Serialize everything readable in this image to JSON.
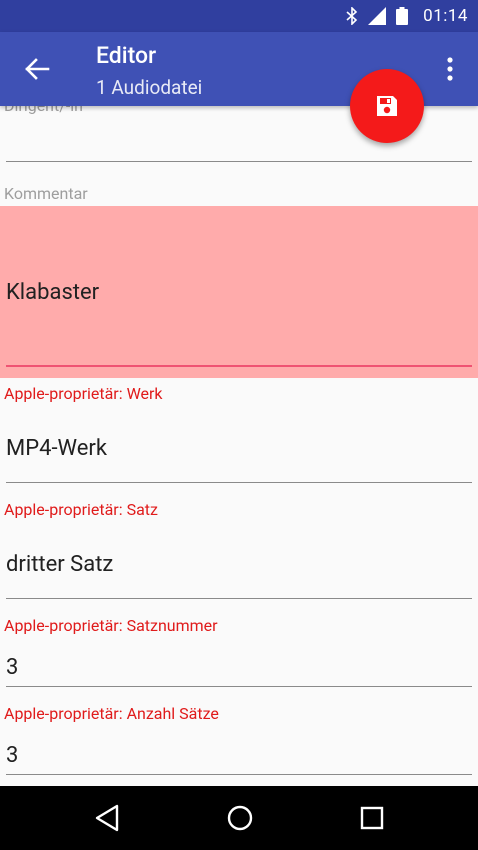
{
  "status_bar": {
    "time": "01:14"
  },
  "app_bar": {
    "title": "Editor",
    "subtitle": "1 Audiodatei"
  },
  "fields": [
    {
      "label": "Dirigent/-in",
      "value": ""
    },
    {
      "label": "Kommentar",
      "value": "Klabaster"
    },
    {
      "label": "Apple-proprietär: Werk",
      "value": "MP4-Werk"
    },
    {
      "label": "Apple-proprietär: Satz",
      "value": "dritter Satz"
    },
    {
      "label": "Apple-proprietär: Satznummer",
      "value": "3"
    },
    {
      "label": "Apple-proprietär: Anzahl Sätze",
      "value": "3"
    }
  ],
  "colors": {
    "status_bar": "#303f9f",
    "app_bar": "#3f51b5",
    "fab": "#f41a1a",
    "highlight": "#ffabab",
    "label_red": "#e01b1b"
  }
}
